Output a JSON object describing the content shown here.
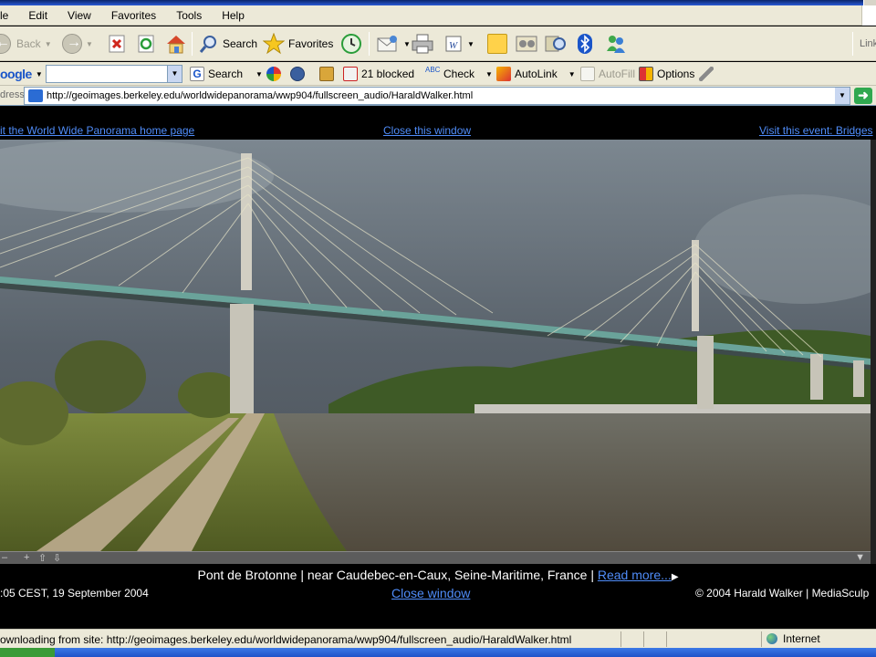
{
  "menu": [
    "le",
    "Edit",
    "View",
    "Favorites",
    "Tools",
    "Help"
  ],
  "toolbar": {
    "back": "Back",
    "search": "Search",
    "favorites": "Favorites",
    "links": "Link"
  },
  "google_bar": {
    "logo": "oogle",
    "search_label": "Search",
    "blocked": "21 blocked",
    "check": "Check",
    "autolink": "AutoLink",
    "autofill": "AutoFill",
    "options": "Options"
  },
  "address": {
    "label": "dress",
    "url": "http://geoimages.berkeley.edu/worldwidepanorama/wwp904/fullscreen_audio/HaraldWalker.html"
  },
  "page": {
    "link_home": "it the World Wide Panorama home page",
    "link_close_top": "Close this window",
    "link_event": "Visit this event: Bridges",
    "caption": "Pont de Brotonne | near Caudebec-en-Caux, Seine-Maritime, France | ",
    "read_more": "Read more...",
    "timestamp": ":05 CEST, 19 September 2004",
    "close_window": "Close window",
    "copyright": "© 2004 Harald Walker | MediaSculp"
  },
  "status": {
    "message": "ownloading from site: http://geoimages.berkeley.edu/worldwidepanorama/wwp904/fullscreen_audio/HaraldWalker.html",
    "zone": "Internet"
  },
  "colors": {
    "chrome": "#ece9d8",
    "link": "#4f8cf8",
    "sky": "#5d6670",
    "water": "#5e5a4e"
  }
}
